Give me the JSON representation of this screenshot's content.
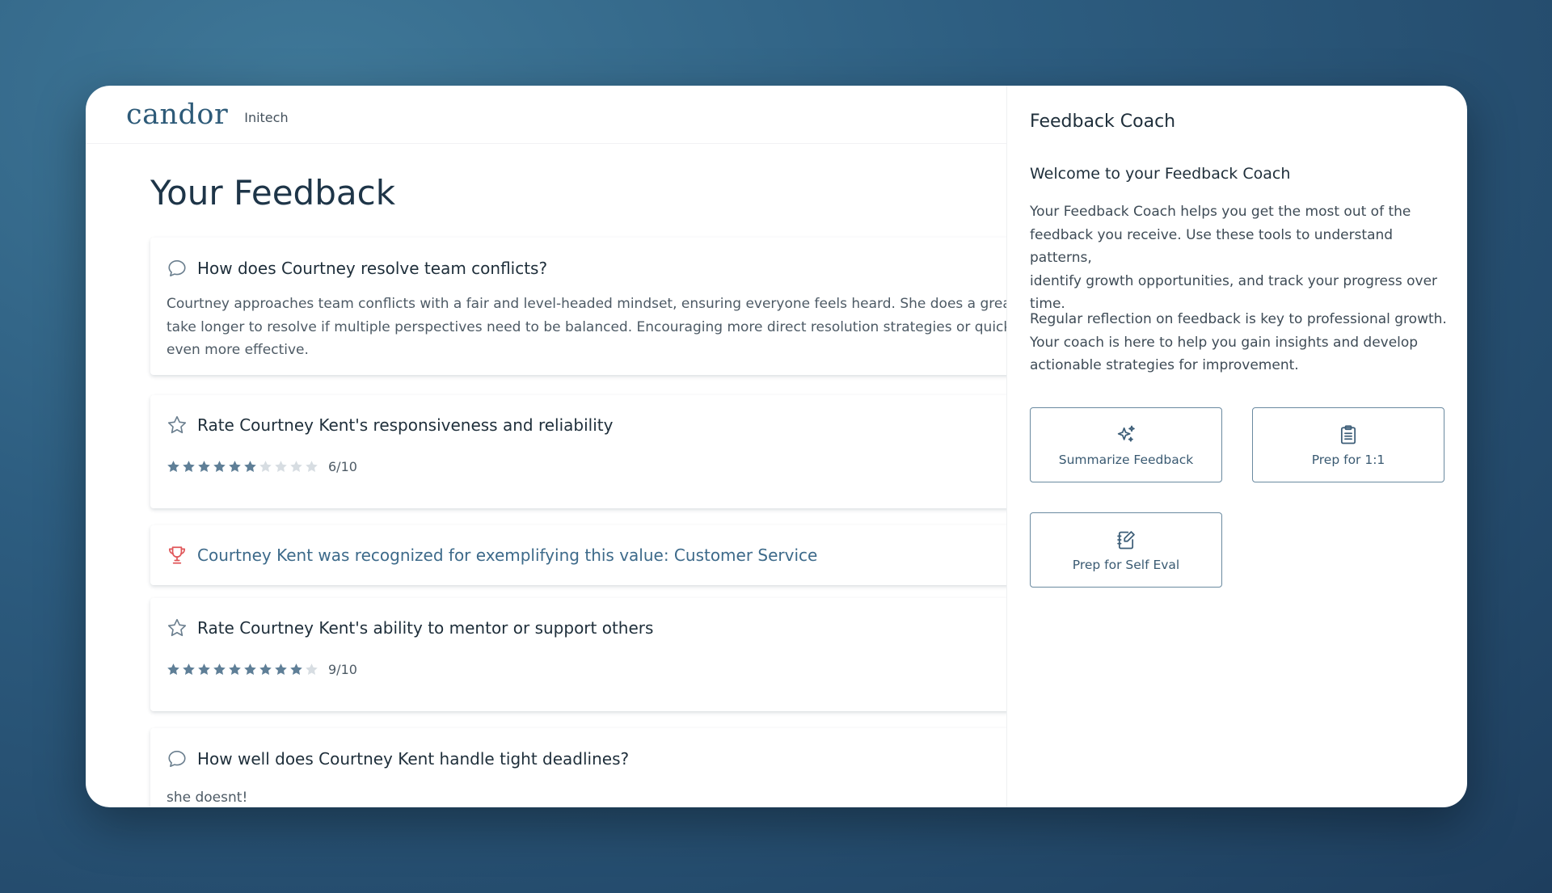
{
  "header": {
    "logo": "candor",
    "org": "Initech"
  },
  "page": {
    "title": "Your Feedback"
  },
  "feedback": [
    {
      "type": "question",
      "icon": "speech-bubble-icon",
      "title": "How does Courtney resolve team conflicts?",
      "lines": [
        "Courtney approaches team conflicts with a fair and level-headed mindset, ensuring everyone feels heard. She does a great job of",
        "take longer to resolve if multiple perspectives need to be balanced. Encouraging more direct resolution strategies or quicker dec",
        "even more effective."
      ]
    },
    {
      "type": "rating",
      "icon": "star-outline-icon",
      "title": "Rate Courtney Kent's responsiveness and reliability",
      "rating": 6,
      "max": 10,
      "rating_label": "6/10"
    },
    {
      "type": "recognition",
      "icon": "trophy-icon",
      "title": "Courtney Kent was recognized for exemplifying this value: Customer Service"
    },
    {
      "type": "rating",
      "icon": "star-outline-icon",
      "title": "Rate Courtney Kent's ability to mentor or support others",
      "rating": 9,
      "max": 10,
      "rating_label": "9/10"
    },
    {
      "type": "question",
      "icon": "speech-bubble-icon",
      "title": "How well does Courtney Kent handle tight deadlines?",
      "lines": [
        "she doesnt!"
      ]
    }
  ],
  "coach": {
    "title": "Feedback Coach",
    "welcome": "Welcome to your Feedback Coach",
    "paragraph1": [
      "Your Feedback Coach helps you get the most out of the",
      "feedback you receive. Use these tools to understand patterns,",
      "identify growth opportunities, and track your progress over",
      "time."
    ],
    "paragraph2": [
      "Regular reflection on feedback is key to professional growth.",
      "Your coach is here to help you gain insights and develop",
      "actionable strategies for improvement."
    ],
    "tools": [
      {
        "label": "Summarize Feedback",
        "icon": "sparkle-icon"
      },
      {
        "label": "Prep for 1:1",
        "icon": "clipboard-icon"
      },
      {
        "label": "Prep for Self Eval",
        "icon": "notepad-edit-icon"
      }
    ]
  },
  "colors": {
    "star_filled": "#5f7f97",
    "star_empty": "#d7dde2",
    "trophy": "#e0575a",
    "accent": "#2d5a78"
  }
}
